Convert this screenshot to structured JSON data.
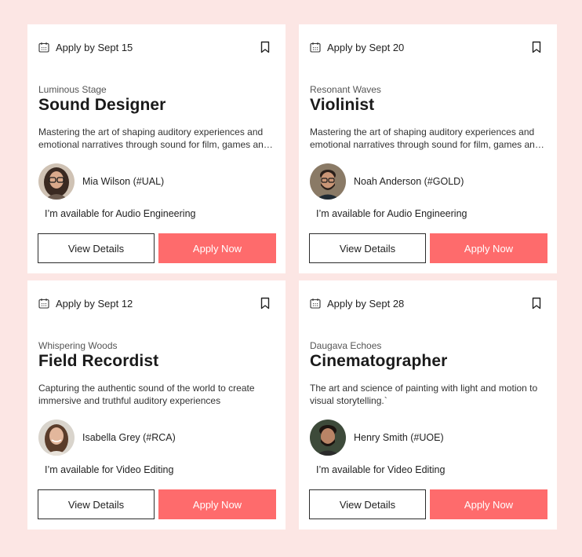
{
  "colors": {
    "background": "#fce6e4",
    "card": "#ffffff",
    "accent": "#fe6b6c",
    "text": "#1e1e1e"
  },
  "cards": [
    {
      "deadline": "Apply by Sept 15",
      "company": "Luminous Stage",
      "title": "Sound Designer",
      "description": "Mastering the art of shaping auditory experiences and emotional narratives through sound for film, games and media.",
      "person": "Mia Wilson (#UAL)",
      "availability": "I’m available for Audio Engineering",
      "view_label": "View Details",
      "apply_label": "Apply Now"
    },
    {
      "deadline": "Apply by Sept 20",
      "company": "Resonant Waves",
      "title": "Violinist",
      "description": "Mastering the art of shaping auditory experiences and emotional narratives through sound for film, games and media.",
      "person": "Noah Anderson (#GOLD)",
      "availability": "I’m available for Audio Engineering",
      "view_label": "View Details",
      "apply_label": "Apply Now"
    },
    {
      "deadline": "Apply by Sept 12",
      "company": "Whispering Woods",
      "title": "Field Recordist",
      "description": "Capturing the authentic sound of the world to create immersive and truthful auditory experiences",
      "person": "Isabella Grey (#RCA)",
      "availability": "I’m available for Video Editing",
      "view_label": "View Details",
      "apply_label": "Apply Now"
    },
    {
      "deadline": "Apply by Sept 28",
      "company": "Daugava Echoes",
      "title": "Cinematographer",
      "description": "The art and science of painting with light and motion to visual storytelling.`",
      "person": "Henry Smith (#UOE)",
      "availability": "I’m available for Video Editing",
      "view_label": "View Details",
      "apply_label": "Apply Now"
    }
  ]
}
